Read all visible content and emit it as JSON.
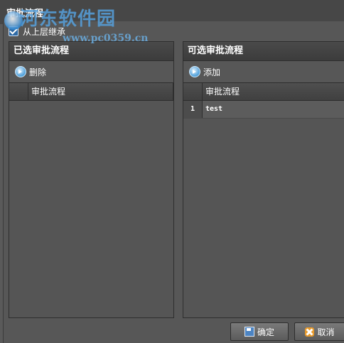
{
  "window": {
    "title": "审批流程"
  },
  "inherit": {
    "label": "从上层继承",
    "checked": true
  },
  "left_panel": {
    "title": "已选审批流程",
    "toolbar_button": "删除",
    "column_header": "审批流程",
    "rows": []
  },
  "right_panel": {
    "title": "可选审批流程",
    "toolbar_button": "添加",
    "column_header": "审批流程",
    "rows": [
      {
        "index": "1",
        "name": "test"
      }
    ]
  },
  "footer": {
    "ok_label": "确定",
    "cancel_label": "取消"
  },
  "watermark": {
    "name": "河东软件园",
    "url": "www.pc0359.cn"
  }
}
